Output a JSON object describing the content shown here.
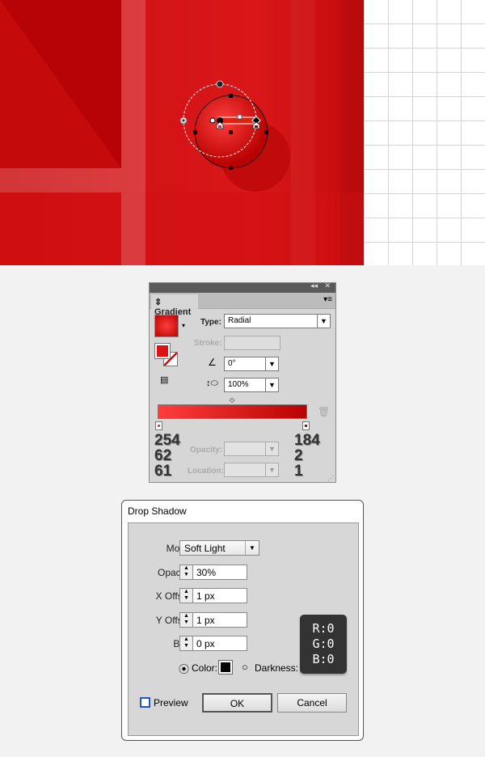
{
  "gradient_panel": {
    "tab": "Gradient",
    "type_label": "Type:",
    "type_value": "Radial",
    "stroke_label": "Stroke:",
    "angle_value": "0°",
    "aspect_value": "100%",
    "opacity_label": "Opacity:",
    "location_label": "Location:",
    "left_stop": {
      "r": "254",
      "g": "62",
      "b": "61",
      "color": "#fe3e3d"
    },
    "right_stop": {
      "r": "184",
      "g": "2",
      "b": "1",
      "color": "#b80201"
    }
  },
  "drop_shadow": {
    "title": "Drop Shadow",
    "mode_label": "Mode:",
    "mode_value": "Soft Light",
    "opacity_label": "Opacity:",
    "opacity_value": "30%",
    "x_offset_label": "X Offset:",
    "x_offset_value": "1 px",
    "y_offset_label": "Y Offset:",
    "y_offset_value": "1 px",
    "blur_label": "Blur:",
    "blur_value": "0 px",
    "color_label": "Color:",
    "darkness_label": "Darkness:",
    "color_swatch": "#000000",
    "preview_label": "Preview",
    "ok_label": "OK",
    "cancel_label": "Cancel",
    "rgb_tooltip": {
      "r": "R:0",
      "g": "G:0",
      "b": "B:0"
    }
  }
}
